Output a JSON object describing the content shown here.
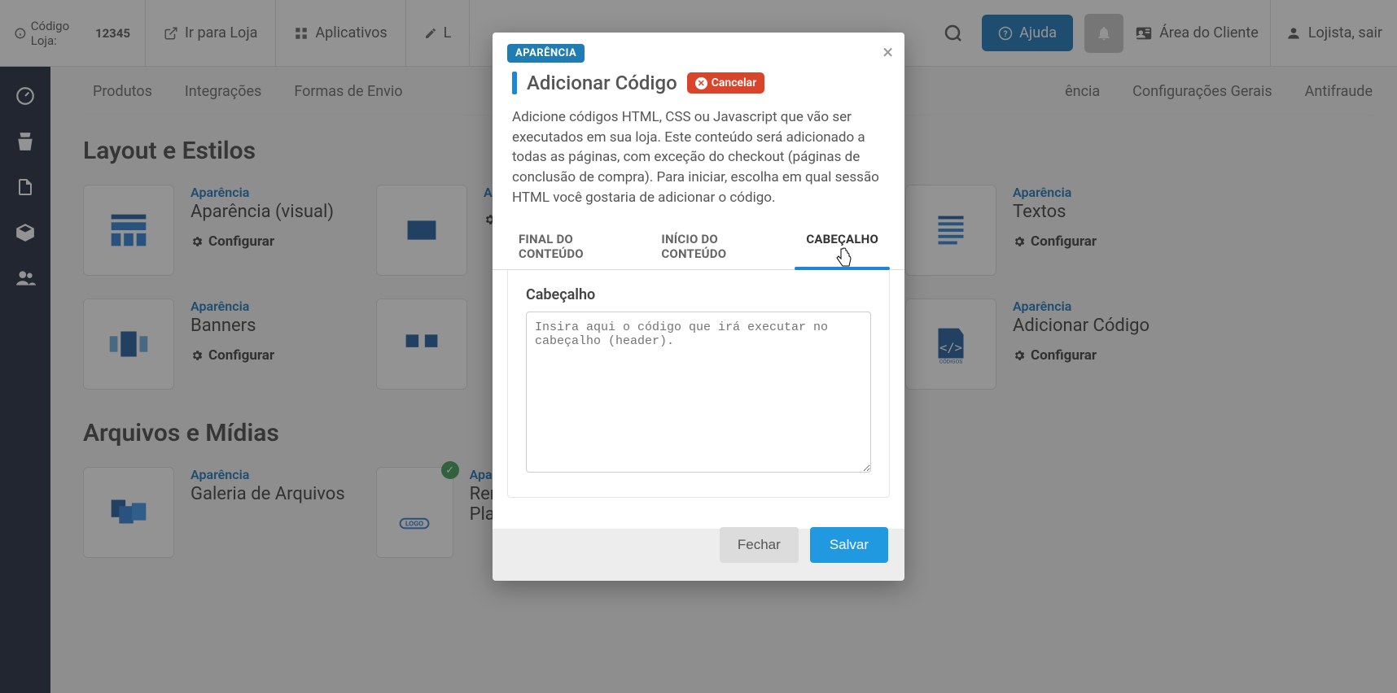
{
  "topbar": {
    "store_code_label": "Código Loja:",
    "store_code": "12345",
    "go_store": "Ir para Loja",
    "apps": "Aplicativos",
    "store_label": "L",
    "help": "Ajuda",
    "client_area": "Área do Cliente",
    "logout": "Lojista, sair"
  },
  "page_tabs": [
    "Produtos",
    "Integrações",
    "Formas de Envio",
    "ência",
    "Configurações Gerais",
    "Antifraude"
  ],
  "sections": {
    "layout_title": "Layout e Estilos",
    "files_title": "Arquivos e Mídias"
  },
  "cards": {
    "cat": "Aparência",
    "configure": "Configurar",
    "row1": [
      "Aparência (visual)",
      " ",
      " ",
      "Textos"
    ],
    "row2": [
      "Banners",
      " ",
      " ",
      "Adicionar Código"
    ],
    "row3": [
      "Galeria de Arquivos",
      "Remover Logo Plataforma"
    ]
  },
  "modal": {
    "tag": "APARÊNCIA",
    "title": "Adicionar Código",
    "cancel": "Cancelar",
    "description": "Adicione códigos HTML, CSS ou Javascript que vão ser executados em sua loja. Este conteúdo será adicionado a todas as páginas, com exceção do checkout (páginas de conclusão de compra). Para iniciar, escolha em qual sessão HTML você gostaria de adicionar o código.",
    "tabs": [
      "FINAL DO CONTEÚDO",
      "INÍCIO DO CONTEÚDO",
      "CABEÇALHO"
    ],
    "active_tab": 2,
    "form_label": "Cabeçalho",
    "placeholder": "Insira aqui o código que irá executar no cabeçalho (header).",
    "close_btn": "Fechar",
    "save_btn": "Salvar"
  }
}
